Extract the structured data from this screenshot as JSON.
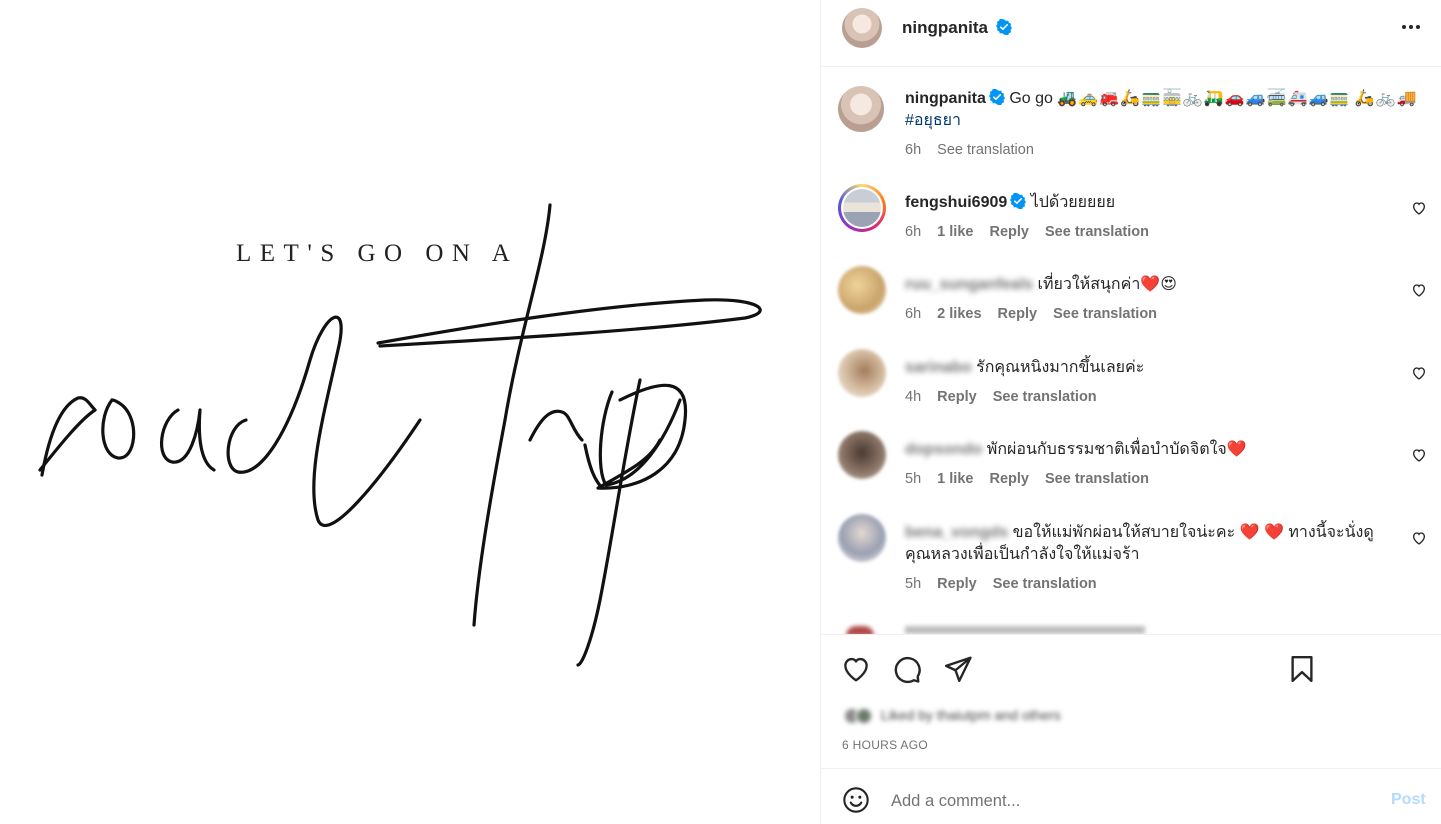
{
  "media": {
    "subtitle": "LET'S GO ON A",
    "script_text": "road trip"
  },
  "header": {
    "username": "ningpanita",
    "verified": true
  },
  "caption": {
    "username": "ningpanita",
    "text": "Go go",
    "emojis_line1": "🚜🚕🚒🛵🚃🚋🚲🛺🚗🚙🚎🚑🚙🚃",
    "emojis_line2": "🛵🚲🚚",
    "hashtag": "#อยุธยา",
    "time": "6h",
    "see_translation": "See translation"
  },
  "comments": [
    {
      "username": "fengshui6909",
      "verified": true,
      "text": "ไปด้วยยยยย",
      "time": "6h",
      "likes": "1 like",
      "reply": "Reply",
      "see_translation": "See translation",
      "blurred": false
    },
    {
      "username": "ruu_sunganfeals",
      "verified": false,
      "text": "เที่ยวให้สนุกค่า❤️😍",
      "time": "6h",
      "likes": "2 likes",
      "reply": "Reply",
      "see_translation": "See translation",
      "blurred": true
    },
    {
      "username": "sarinabo",
      "verified": false,
      "text": "รักคุณหนิงมากขึ้นเลยค่ะ",
      "time": "4h",
      "likes": "",
      "reply": "Reply",
      "see_translation": "See translation",
      "blurred": true
    },
    {
      "username": "dopsondo",
      "verified": false,
      "text": "พักผ่อนกับธรรมชาติเพื่อบำบัดจิตใจ❤️",
      "time": "5h",
      "likes": "1 like",
      "reply": "Reply",
      "see_translation": "See translation",
      "blurred": true
    },
    {
      "username": "bena_vongds",
      "verified": false,
      "text": "ขอให้แม่พักผ่อนให้สบายใจน่ะคะ ❤️ ❤️ ทางนี้จะนั่งดูคุณหลวงเพื่อเป็นกำลังใจให้แม่จร้า",
      "time": "5h",
      "likes": "",
      "reply": "Reply",
      "see_translation": "See translation",
      "blurred": true
    }
  ],
  "actions": {
    "like_icon": "heart-icon",
    "comment_icon": "comment-bubble-icon",
    "share_icon": "paper-plane-icon",
    "save_icon": "bookmark-icon"
  },
  "liked_by_text": "Liked by thaiutpm and others",
  "time_ago": "6 HOURS AGO",
  "add_comment": {
    "placeholder": "Add a comment...",
    "post_label": "Post"
  },
  "colors": {
    "verified": "#0095f6",
    "hashtag": "#00376b",
    "post_disabled": "#b3dbff",
    "meta_text": "#737373",
    "story_ring": [
      "#feda75",
      "#d62976",
      "#962fbf"
    ]
  }
}
